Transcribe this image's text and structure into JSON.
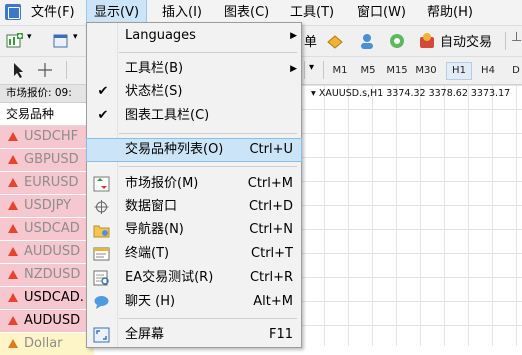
{
  "menubar": {
    "file": "文件(F)",
    "view": "显示(V)",
    "insert": "插入(I)",
    "charts": "图表(C)",
    "tools": "工具(T)",
    "window": "窗口(W)",
    "help": "帮助(H)"
  },
  "toolbar": {
    "new_order_partial": "单",
    "autotrade": "自动交易",
    "timeframes": [
      "M1",
      "M5",
      "M15",
      "M30",
      "H1",
      "H4",
      "D"
    ]
  },
  "market_watch": {
    "header": "市场报价: 09:",
    "col_symbol": "交易品种",
    "symbols": [
      "USDCHF",
      "GBPUSD",
      "EURUSD",
      "USDJPY",
      "USDCAD",
      "AUDUSD",
      "NZDUSD",
      "USDCAD.",
      "AUDUSD",
      "Dollar"
    ]
  },
  "chart": {
    "title": "XAUUSD.s,H1  3374.32 3378.62 3373.17"
  },
  "view_menu": {
    "languages": "Languages",
    "toolbars": "工具栏(B)",
    "statusbar": "状态栏(S)",
    "chart_toolbar": "图表工具栏(C)",
    "symbols": "交易品种列表(O)",
    "symbols_key": "Ctrl+U",
    "market_watch": "市场报价(M)",
    "market_watch_key": "Ctrl+M",
    "data_window": "数据窗口",
    "data_window_key": "Ctrl+D",
    "navigator": "导航器(N)",
    "navigator_key": "Ctrl+N",
    "terminal": "终端(T)",
    "terminal_key": "Ctrl+T",
    "strategy_tester": "EA交易测试(R)",
    "strategy_tester_key": "Ctrl+R",
    "chat": "聊天 (H)",
    "chat_key": "Alt+M",
    "fullscreen": "全屏幕",
    "fullscreen_key": "F11",
    "check_mark": "✔",
    "submenu_arrow": "▶"
  },
  "colors": {
    "highlight": "#cce4f7",
    "row_pink": "#f7c7cf",
    "row_yellow": "#fdf5c8",
    "up_arrow": "#e8432d"
  }
}
